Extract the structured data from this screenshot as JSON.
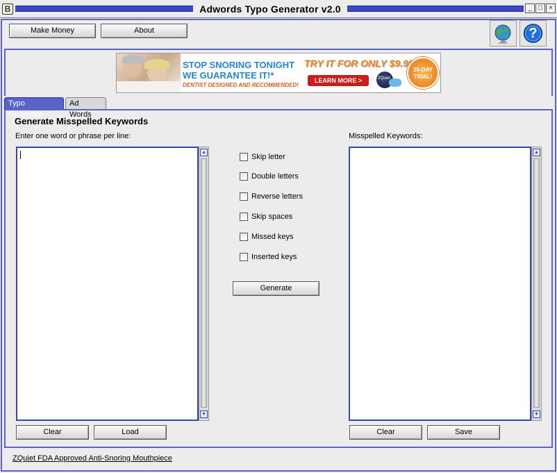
{
  "window": {
    "title": "Adwords Typo Generator v2.0",
    "app_icon_glyph": "B",
    "controls": {
      "minimize": "_",
      "maximize": "□",
      "close": "×"
    }
  },
  "toolbar": {
    "make_money": "Make Money",
    "about": "About",
    "globe_icon": "globe-icon",
    "help_icon": "help-icon",
    "help_glyph": "?"
  },
  "ad": {
    "line1": "STOP SNORING TONIGHT",
    "line2": "WE GUARANTEE IT!*",
    "line3": "DENTIST DESIGNED AND RECOMMENDED!",
    "offer": "TRY IT FOR ONLY $9.95!",
    "learn_more": "LEARN MORE >",
    "badge_line1": "30-DAY",
    "badge_line2": "TRIAL!",
    "brand": "ZQuiet"
  },
  "tabs": [
    {
      "label": "Typo Generator",
      "active": true
    },
    {
      "label": "Ad Words",
      "active": false
    }
  ],
  "main": {
    "heading": "Generate Misspelled Keywords",
    "input_label": "Enter one word or phrase per line:",
    "output_label": "Misspelled Keywords:",
    "input_value": "",
    "output_value": "",
    "options": [
      {
        "label": "Skip letter",
        "checked": false
      },
      {
        "label": "Double letters",
        "checked": false
      },
      {
        "label": "Reverse letters",
        "checked": false
      },
      {
        "label": "Skip spaces",
        "checked": false
      },
      {
        "label": "Missed keys",
        "checked": false
      },
      {
        "label": "Inserted keys",
        "checked": false
      }
    ],
    "generate": "Generate",
    "clear_left": "Clear",
    "load": "Load",
    "clear_right": "Clear",
    "save": "Save"
  },
  "footer": {
    "link": "ZQuiet FDA Approved Anti-Snoring Mouthpiece"
  },
  "colors": {
    "accent": "#5a64c8",
    "title_stripe": "#3d48c8",
    "tab_active": "#5a64c8",
    "ad_blue": "#1f88c8",
    "ad_red": "#cc1d1d",
    "badge_orange": "#f08a1e"
  }
}
